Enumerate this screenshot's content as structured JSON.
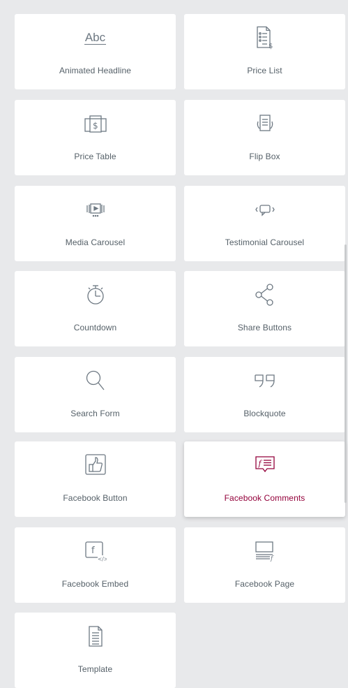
{
  "widgets": [
    {
      "label": "Animated Headline",
      "icon": "animated-headline-icon",
      "icon_text": "Abc"
    },
    {
      "label": "Price List",
      "icon": "price-list-icon"
    },
    {
      "label": "Price Table",
      "icon": "price-table-icon"
    },
    {
      "label": "Flip Box",
      "icon": "flip-box-icon"
    },
    {
      "label": "Media Carousel",
      "icon": "media-carousel-icon"
    },
    {
      "label": "Testimonial Carousel",
      "icon": "testimonial-carousel-icon"
    },
    {
      "label": "Countdown",
      "icon": "countdown-icon"
    },
    {
      "label": "Share Buttons",
      "icon": "share-icon"
    },
    {
      "label": "Search Form",
      "icon": "search-icon"
    },
    {
      "label": "Blockquote",
      "icon": "blockquote-icon"
    },
    {
      "label": "Facebook Button",
      "icon": "facebook-like-icon"
    },
    {
      "label": "Facebook Comments",
      "icon": "facebook-comments-icon",
      "active": true
    },
    {
      "label": "Facebook Embed",
      "icon": "facebook-embed-icon"
    },
    {
      "label": "Facebook Page",
      "icon": "facebook-page-icon"
    },
    {
      "label": "Template",
      "icon": "template-icon"
    }
  ],
  "colors": {
    "background": "#e8e9eb",
    "card": "#ffffff",
    "text": "#556068",
    "icon": "#6d7882",
    "active": "#93003a"
  }
}
